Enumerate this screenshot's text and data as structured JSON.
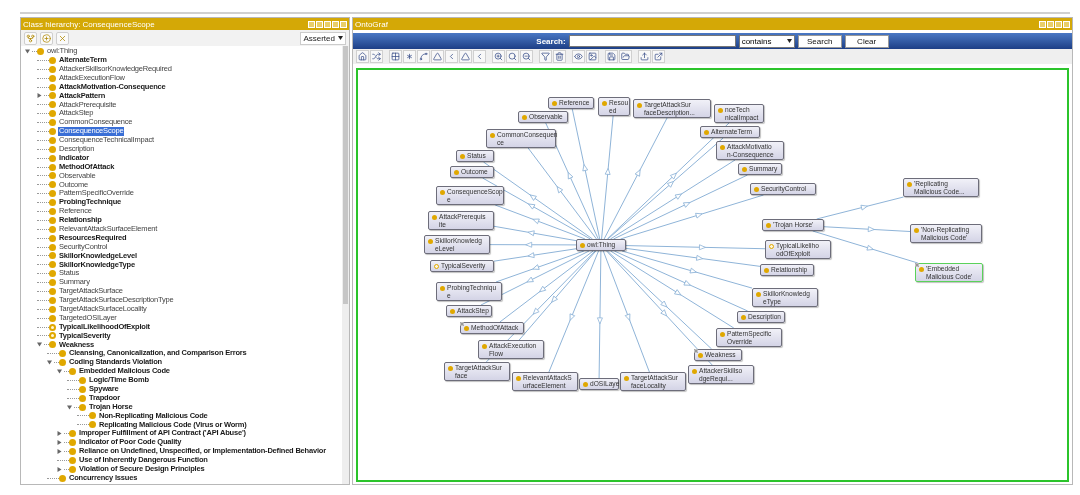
{
  "class_hierarchy": {
    "title": "Class hierarchy: ConsequenceScope",
    "view": "Asserted",
    "items": [
      {
        "label": "owl:Thing",
        "bold": false,
        "hollow": false,
        "selected": false,
        "kind": "branch",
        "expanded": true,
        "children": [
          {
            "label": "AlternateTerm",
            "bold": true,
            "hollow": false,
            "selected": false,
            "kind": "leaf"
          },
          {
            "label": "AttackerSkillsorKnowledgeRequired",
            "bold": false,
            "hollow": false,
            "selected": false,
            "kind": "leaf"
          },
          {
            "label": "AttackExecutionFlow",
            "bold": false,
            "hollow": false,
            "selected": false,
            "kind": "leaf"
          },
          {
            "label": "AttackMotivation-Consequence",
            "bold": true,
            "hollow": false,
            "selected": false,
            "kind": "leaf"
          },
          {
            "label": "AttackPattern",
            "bold": true,
            "hollow": false,
            "selected": false,
            "kind": "branch",
            "expanded": false
          },
          {
            "label": "AttackPrerequisite",
            "bold": false,
            "hollow": false,
            "selected": false,
            "kind": "leaf"
          },
          {
            "label": "AttackStep",
            "bold": false,
            "hollow": false,
            "selected": false,
            "kind": "leaf"
          },
          {
            "label": "CommonConsequence",
            "bold": false,
            "hollow": false,
            "selected": false,
            "kind": "leaf"
          },
          {
            "label": "ConsequenceScope",
            "bold": false,
            "hollow": false,
            "selected": true,
            "kind": "leaf"
          },
          {
            "label": "ConsequenceTechnicalImpact",
            "bold": false,
            "hollow": false,
            "selected": false,
            "kind": "leaf"
          },
          {
            "label": "Description",
            "bold": false,
            "hollow": false,
            "selected": false,
            "kind": "leaf"
          },
          {
            "label": "Indicator",
            "bold": true,
            "hollow": false,
            "selected": false,
            "kind": "leaf"
          },
          {
            "label": "MethodOfAttack",
            "bold": true,
            "hollow": false,
            "selected": false,
            "kind": "leaf"
          },
          {
            "label": "Observable",
            "bold": false,
            "hollow": false,
            "selected": false,
            "kind": "leaf"
          },
          {
            "label": "Outcome",
            "bold": false,
            "hollow": false,
            "selected": false,
            "kind": "leaf"
          },
          {
            "label": "PatternSpecificOverride",
            "bold": false,
            "hollow": false,
            "selected": false,
            "kind": "leaf"
          },
          {
            "label": "ProbingTechnique",
            "bold": true,
            "hollow": false,
            "selected": false,
            "kind": "leaf"
          },
          {
            "label": "Reference",
            "bold": false,
            "hollow": false,
            "selected": false,
            "kind": "leaf"
          },
          {
            "label": "Relationship",
            "bold": true,
            "hollow": false,
            "selected": false,
            "kind": "leaf"
          },
          {
            "label": "RelevantAttackSurfaceElement",
            "bold": false,
            "hollow": false,
            "selected": false,
            "kind": "leaf"
          },
          {
            "label": "ResourcesRequired",
            "bold": true,
            "hollow": false,
            "selected": false,
            "kind": "leaf"
          },
          {
            "label": "SecurityControl",
            "bold": false,
            "hollow": false,
            "selected": false,
            "kind": "leaf"
          },
          {
            "label": "SkillorKnowledgeLevel",
            "bold": true,
            "hollow": false,
            "selected": false,
            "kind": "leaf"
          },
          {
            "label": "SkillorKnowledgeType",
            "bold": true,
            "hollow": false,
            "selected": false,
            "kind": "leaf"
          },
          {
            "label": "Status",
            "bold": false,
            "hollow": false,
            "selected": false,
            "kind": "leaf"
          },
          {
            "label": "Summary",
            "bold": false,
            "hollow": false,
            "selected": false,
            "kind": "leaf"
          },
          {
            "label": "TargetAttackSurface",
            "bold": false,
            "hollow": false,
            "selected": false,
            "kind": "leaf"
          },
          {
            "label": "TargetAttackSurfaceDescriptionType",
            "bold": false,
            "hollow": false,
            "selected": false,
            "kind": "leaf"
          },
          {
            "label": "TargetAttackSurfaceLocality",
            "bold": false,
            "hollow": false,
            "selected": false,
            "kind": "leaf"
          },
          {
            "label": "TargetedOSILayer",
            "bold": false,
            "hollow": false,
            "selected": false,
            "kind": "leaf"
          },
          {
            "label": "TypicalLikelihoodOfExploit",
            "bold": true,
            "hollow": true,
            "selected": false,
            "kind": "leaf"
          },
          {
            "label": "TypicalSeverity",
            "bold": true,
            "hollow": true,
            "selected": false,
            "kind": "leaf"
          },
          {
            "label": "Weakness",
            "bold": true,
            "hollow": false,
            "selected": false,
            "kind": "branch",
            "expanded": true,
            "children": [
              {
                "label": "Cleansing, Canonicalization, and Comparison Errors",
                "bold": true,
                "hollow": false,
                "selected": false,
                "kind": "leaf"
              },
              {
                "label": "Coding Standards Violation",
                "bold": true,
                "hollow": false,
                "selected": false,
                "kind": "branch",
                "expanded": true,
                "children": [
                  {
                    "label": "Embedded Malicious Code",
                    "bold": true,
                    "hollow": false,
                    "selected": false,
                    "kind": "branch",
                    "expanded": true,
                    "children": [
                      {
                        "label": "Logic/Time Bomb",
                        "bold": true,
                        "hollow": false,
                        "selected": false,
                        "kind": "leaf"
                      },
                      {
                        "label": "Spyware",
                        "bold": true,
                        "hollow": false,
                        "selected": false,
                        "kind": "leaf"
                      },
                      {
                        "label": "Trapdoor",
                        "bold": true,
                        "hollow": false,
                        "selected": false,
                        "kind": "leaf"
                      },
                      {
                        "label": "Trojan Horse",
                        "bold": true,
                        "hollow": false,
                        "selected": false,
                        "kind": "branch",
                        "expanded": true,
                        "children": [
                          {
                            "label": "Non-Replicating Malicious Code",
                            "bold": true,
                            "hollow": false,
                            "selected": false,
                            "kind": "leaf"
                          },
                          {
                            "label": "Replicating Malicious Code (Virus or Worm)",
                            "bold": true,
                            "hollow": false,
                            "selected": false,
                            "kind": "leaf"
                          }
                        ]
                      }
                    ]
                  },
                  {
                    "label": "Improper Fulfillment of API Contract ('API Abuse')",
                    "bold": true,
                    "hollow": false,
                    "selected": false,
                    "kind": "branch",
                    "expanded": false
                  },
                  {
                    "label": "Indicator of Poor Code Quality",
                    "bold": true,
                    "hollow": false,
                    "selected": false,
                    "kind": "branch",
                    "expanded": false
                  },
                  {
                    "label": "Reliance on Undefined, Unspecified, or Implementation-Defined Behavior",
                    "bold": true,
                    "hollow": false,
                    "selected": false,
                    "kind": "branch",
                    "expanded": false
                  },
                  {
                    "label": "Use of Inherently Dangerous Function",
                    "bold": true,
                    "hollow": false,
                    "selected": false,
                    "kind": "leaf"
                  },
                  {
                    "label": "Violation of Secure Design Principles",
                    "bold": true,
                    "hollow": false,
                    "selected": false,
                    "kind": "branch",
                    "expanded": false
                  }
                ]
              },
              {
                "label": "Concurrency Issues",
                "bold": true,
                "hollow": false,
                "selected": false,
                "kind": "leaf"
              }
            ]
          }
        ]
      }
    ]
  },
  "ontograf": {
    "title": "OntoGraf",
    "search_label": "Search:",
    "match_mode": "contains",
    "buttons": [
      "Search",
      "Clear"
    ],
    "graph": {
      "nodes": [
        {
          "lines": [
            "owl:Thing"
          ],
          "hollow": false,
          "selected": false,
          "expand": false,
          "children": [
            {
              "lines": [
                "Reference"
              ],
              "hollow": false,
              "selected": false,
              "expand": false
            },
            {
              "lines": [
                "Observable"
              ],
              "hollow": false,
              "selected": false,
              "expand": false
            },
            {
              "lines": [
                "Resou",
                "ed"
              ],
              "hollow": false,
              "selected": false,
              "expand": false
            },
            {
              "lines": [
                "TargetAttackSur",
                "faceDescription..."
              ],
              "hollow": false,
              "selected": false,
              "expand": false
            },
            {
              "lines": [
                "nceTech",
                "nicalImpact"
              ],
              "hollow": false,
              "selected": false,
              "expand": false
            },
            {
              "lines": [
                "CommonConsequen",
                "ce"
              ],
              "hollow": false,
              "selected": false,
              "expand": false
            },
            {
              "lines": [
                "AlternateTerm"
              ],
              "hollow": false,
              "selected": false,
              "expand": false
            },
            {
              "lines": [
                "Status"
              ],
              "hollow": false,
              "selected": false,
              "expand": false
            },
            {
              "lines": [
                "AttackMotivatio",
                "n-Consequence"
              ],
              "hollow": false,
              "selected": false,
              "expand": false
            },
            {
              "lines": [
                "Outcome"
              ],
              "hollow": false,
              "selected": false,
              "expand": false
            },
            {
              "lines": [
                "Summary"
              ],
              "hollow": false,
              "selected": false,
              "expand": false
            },
            {
              "lines": [
                "ConsequenceScop",
                "e"
              ],
              "hollow": false,
              "selected": false,
              "expand": false
            },
            {
              "lines": [
                "SecurityControl"
              ],
              "hollow": false,
              "selected": false,
              "expand": false
            },
            {
              "lines": [
                "AttackPrerequis",
                "ite"
              ],
              "hollow": false,
              "selected": false,
              "expand": false
            },
            {
              "lines": [
                "SkillorKnowledg",
                "eLevel"
              ],
              "hollow": false,
              "selected": false,
              "expand": false
            },
            {
              "lines": [
                "TypicalLikeliho",
                "odOfExploit"
              ],
              "hollow": true,
              "selected": false,
              "expand": false
            },
            {
              "lines": [
                "TypicalSeverity"
              ],
              "hollow": true,
              "selected": false,
              "expand": false
            },
            {
              "lines": [
                "Relationship"
              ],
              "hollow": false,
              "selected": false,
              "expand": false
            },
            {
              "lines": [
                "ProbingTechniqu",
                "e"
              ],
              "hollow": false,
              "selected": false,
              "expand": false
            },
            {
              "lines": [
                "AttackStep"
              ],
              "hollow": false,
              "selected": false,
              "expand": false
            },
            {
              "lines": [
                "SkillorKnowledg",
                "eType"
              ],
              "hollow": false,
              "selected": false,
              "expand": false
            },
            {
              "lines": [
                "MethodOfAttack"
              ],
              "hollow": false,
              "selected": false,
              "expand": true
            },
            {
              "lines": [
                "Description"
              ],
              "hollow": false,
              "selected": false,
              "expand": false
            },
            {
              "lines": [
                "AttackExecution",
                "Flow"
              ],
              "hollow": false,
              "selected": false,
              "expand": false
            },
            {
              "lines": [
                "PatternSpecific",
                "Override"
              ],
              "hollow": false,
              "selected": false,
              "expand": false
            },
            {
              "lines": [
                "Weakness"
              ],
              "hollow": false,
              "selected": false,
              "expand": true
            },
            {
              "lines": [
                "TargetAttackSur",
                "face"
              ],
              "hollow": false,
              "selected": false,
              "expand": false
            },
            {
              "lines": [
                "RelevantAttackS",
                "urfaceElement"
              ],
              "hollow": false,
              "selected": false,
              "expand": false
            },
            {
              "lines": [
                "dOSILaye"
              ],
              "hollow": false,
              "selected": false,
              "expand": false
            },
            {
              "lines": [
                "TargetAttackSur",
                "faceLocality"
              ],
              "hollow": false,
              "selected": false,
              "expand": false
            },
            {
              "lines": [
                "AttackerSkillso",
                "dgeRequi..."
              ],
              "hollow": false,
              "selected": false,
              "expand": false
            }
          ]
        },
        {
          "lines": [
            "'Trojan Horse'"
          ],
          "hollow": false,
          "selected": false,
          "expand": false,
          "children": [
            {
              "lines": [
                "'Replicating",
                "Malicious Code..."
              ],
              "hollow": false,
              "selected": false,
              "expand": false
            },
            {
              "lines": [
                "'Non-Replicating",
                "Malicious Code'"
              ],
              "hollow": false,
              "selected": false,
              "expand": false
            },
            {
              "lines": [
                "'Embedded",
                "Malicious Code'"
              ],
              "hollow": false,
              "selected": true,
              "expand": true
            }
          ]
        }
      ]
    }
  }
}
